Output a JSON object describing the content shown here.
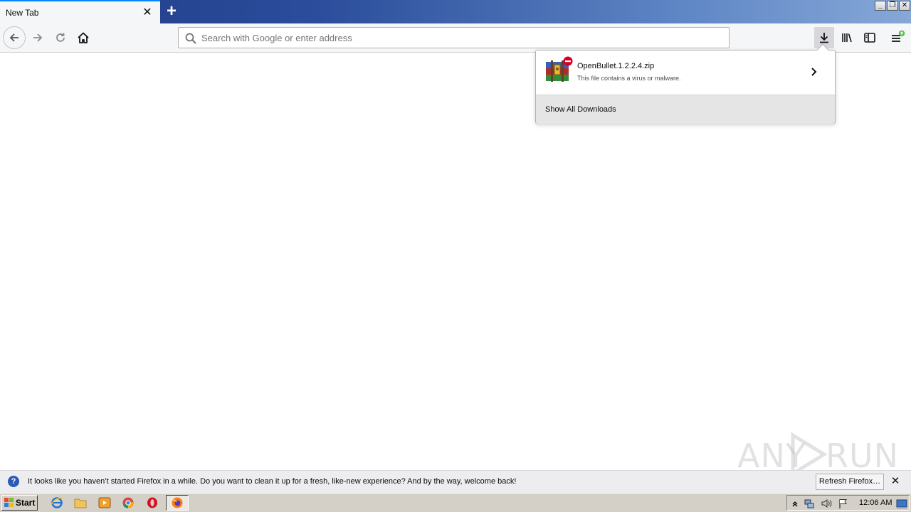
{
  "browser": {
    "tab": {
      "title": "New Tab"
    },
    "window_controls": {
      "minimize": "_",
      "restore": "❐",
      "close": "✕"
    }
  },
  "navbar": {
    "urlbar": {
      "placeholder": "Search with Google or enter address",
      "value": ""
    }
  },
  "downloads_panel": {
    "item": {
      "filename": "OpenBullet.1.2.2.4.zip",
      "status": "This file contains a virus or malware."
    },
    "footer_label": "Show All Downloads"
  },
  "notification": {
    "message": "It looks like you haven’t started Firefox in a while. Do you want to clean it up for a fresh, like-new experience? And by the way, welcome back!",
    "button_label": "Refresh Firefox…"
  },
  "taskbar": {
    "start_label": "Start",
    "clock": "12:06 AM"
  },
  "watermark": {
    "text_left": "ANY",
    "text_right": "RUN"
  },
  "colors": {
    "accent": "#0a84ff",
    "tabstrip_start": "#1f3a86",
    "tabstrip_end": "#86a8d8",
    "toolbar": "#f5f6f7",
    "blocked_badge": "#d70022"
  }
}
